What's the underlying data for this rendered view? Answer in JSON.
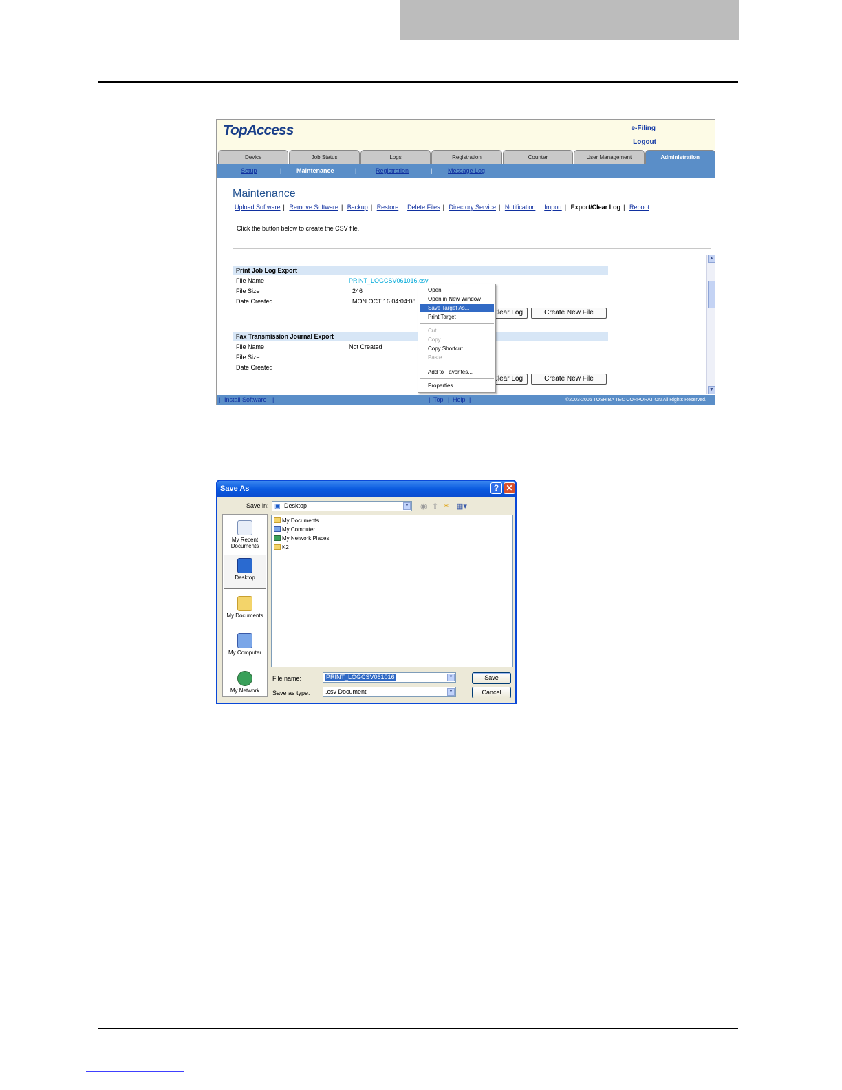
{
  "browser": {
    "logo": "TopAccess",
    "header_links": {
      "efiling": "e-Filing",
      "logout": "Logout"
    },
    "tabs": [
      "Device",
      "Job Status",
      "Logs",
      "Registration",
      "Counter",
      "User Management",
      "Administration"
    ],
    "active_tab": "Administration",
    "subnav": [
      "Setup",
      "Maintenance",
      "Registration",
      "Message Log"
    ],
    "subnav_sep": "|",
    "page_title": "Maintenance",
    "maintenance_links": [
      "Upload Software",
      "Remove Software",
      "Backup",
      "Restore",
      "Delete Files",
      "Directory Service",
      "Notification",
      "Import",
      "Export/Clear Log",
      "Reboot"
    ],
    "instruction": "Click the button below to create the CSV file.",
    "sections": [
      {
        "title": "Print Job Log Export",
        "labels": [
          "File Name",
          "File Size",
          "Date Created"
        ],
        "file_name": "PRINT_LOGCSV061016.csv",
        "file_size": "246",
        "date_created": "MON OCT 16 04:04:08",
        "clear_btn": "Clear Log",
        "create_btn": "Create New File"
      },
      {
        "title": "Fax Transmission Journal Export",
        "labels": [
          "File Name",
          "File Size",
          "Date Created"
        ],
        "file_name": "Not Created",
        "file_size": "",
        "date_created": "",
        "clear_btn": "Clear Log",
        "create_btn": "Create New File"
      }
    ],
    "footer": {
      "install": "Install Software",
      "top": "Top",
      "help": "Help",
      "copyright": "©2003-2006 TOSHIBA TEC CORPORATION All Rights Reserved."
    },
    "context_menu": [
      "Open",
      "Open in New Window",
      "Save Target As...",
      "Print Target",
      "Cut",
      "Copy",
      "Copy Shortcut",
      "Paste",
      "Add to Favorites...",
      "Properties"
    ]
  },
  "dialog": {
    "title": "Save As",
    "help": "?",
    "close": "✕",
    "save_in_label": "Save in:",
    "save_in_value": "Desktop",
    "places": [
      "My Recent Documents",
      "Desktop",
      "My Documents",
      "My Computer",
      "My Network"
    ],
    "files": [
      "My Documents",
      "My Computer",
      "My Network Places",
      "K2"
    ],
    "file_name_label": "File name:",
    "file_name_value": "PRINT_LOGCSV061016",
    "save_type_label": "Save as type:",
    "save_type_value": ".csv Document",
    "save_btn": "Save",
    "cancel_btn": "Cancel"
  }
}
